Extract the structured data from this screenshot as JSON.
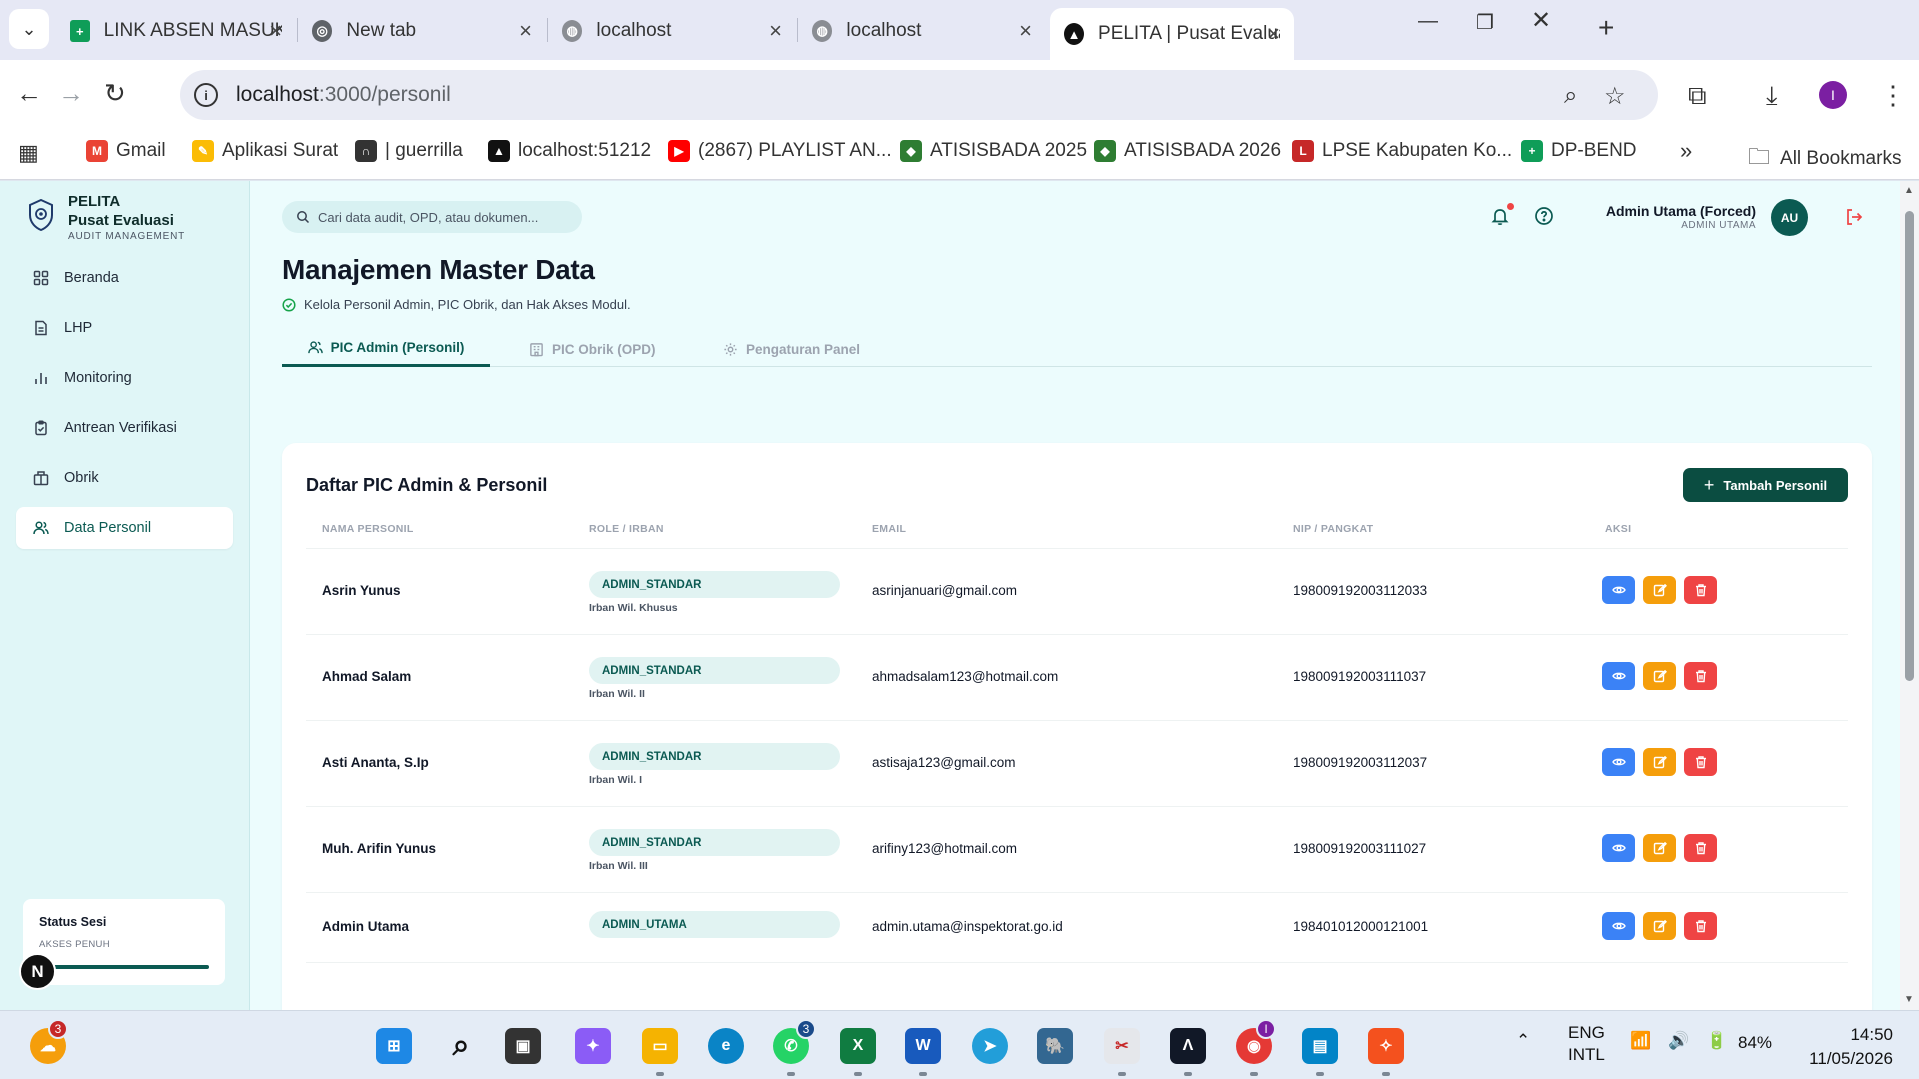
{
  "browser": {
    "tabs": [
      {
        "title": "LINK ABSEN MASUK PETU",
        "active": false
      },
      {
        "title": "New tab",
        "active": false
      },
      {
        "title": "localhost",
        "active": false
      },
      {
        "title": "localhost",
        "active": false
      },
      {
        "title": "PELITA | Pusat Evaluasi La",
        "active": true
      }
    ],
    "url_host": "localhost",
    "url_path": ":3000/personil",
    "bookmarks": [
      "Gmail",
      "Aplikasi Surat",
      "| guerrilla",
      "localhost:51212",
      "(2867) PLAYLIST AN...",
      "ATISISBADA 2025",
      "ATISISBADA 2026",
      "LPSE Kabupaten Ko...",
      "DP-BEND"
    ],
    "all_bookmarks": "All Bookmarks",
    "profile_initial": "I"
  },
  "sidebar": {
    "brand_line1": "PELITA",
    "brand_line2": "Pusat Evaluasi",
    "brand_line3": "AUDIT MANAGEMENT",
    "items": [
      {
        "label": "Beranda",
        "icon": "grid-icon",
        "active": false
      },
      {
        "label": "LHP",
        "icon": "document-icon",
        "active": false
      },
      {
        "label": "Monitoring",
        "icon": "bar-chart-icon",
        "active": false
      },
      {
        "label": "Antrean Verifikasi",
        "icon": "clipboard-check-icon",
        "active": false
      },
      {
        "label": "Obrik",
        "icon": "building-icon",
        "active": false
      },
      {
        "label": "Data Personil",
        "icon": "users-icon",
        "active": true
      }
    ],
    "status_title": "Status Sesi",
    "status_sub": "AKSES PENUH",
    "floating_avatar": "N"
  },
  "header": {
    "search_placeholder": "Cari data audit, OPD, atau dokumen...",
    "user_name": "Admin Utama (Forced)",
    "user_role": "ADMIN UTAMA",
    "user_initials": "AU"
  },
  "page": {
    "title": "Manajemen Master Data",
    "subtitle": "Kelola Personil Admin, PIC Obrik, dan Hak Akses Modul.",
    "tabs": [
      {
        "label": "PIC Admin (Personil)",
        "active": true
      },
      {
        "label": "PIC Obrik (OPD)",
        "active": false
      },
      {
        "label": "Pengaturan Panel",
        "active": false
      }
    ]
  },
  "table": {
    "title": "Daftar PIC Admin & Personil",
    "add_button": "Tambah Personil",
    "columns": [
      "NAMA PERSONIL",
      "ROLE / IRBAN",
      "EMAIL",
      "NIP / PANGKAT",
      "AKSI"
    ],
    "rows": [
      {
        "name": "Asrin Yunus",
        "role": "ADMIN_STANDAR",
        "irban": "Irban Wil. Khusus",
        "email": "asrinjanuari@gmail.com",
        "nip": "198009192003112033"
      },
      {
        "name": "Ahmad Salam",
        "role": "ADMIN_STANDAR",
        "irban": "Irban Wil. II",
        "email": "ahmadsalam123@hotmail.com",
        "nip": "198009192003111037"
      },
      {
        "name": "Asti Ananta, S.Ip",
        "role": "ADMIN_STANDAR",
        "irban": "Irban Wil. I",
        "email": "astisaja123@gmail.com",
        "nip": "198009192003112037"
      },
      {
        "name": "Muh. Arifin Yunus",
        "role": "ADMIN_STANDAR",
        "irban": "Irban Wil. III",
        "email": "arifiny123@hotmail.com",
        "nip": "198009192003111027"
      },
      {
        "name": "Admin Utama",
        "role": "ADMIN_UTAMA",
        "irban": "",
        "email": "admin.utama@inspektorat.go.id",
        "nip": "198401012000121001"
      }
    ]
  },
  "taskbar": {
    "weather_badge": "3",
    "whatsapp_badge": "3",
    "lang_line1": "ENG",
    "lang_line2": "INTL",
    "battery": "84%",
    "time": "14:50",
    "date": "11/05/2026"
  },
  "colors": {
    "accent": "#0b5a52",
    "button_dark": "#0b4d41",
    "view": "#3b82f6",
    "edit": "#f59e0b",
    "delete": "#ef4444"
  }
}
